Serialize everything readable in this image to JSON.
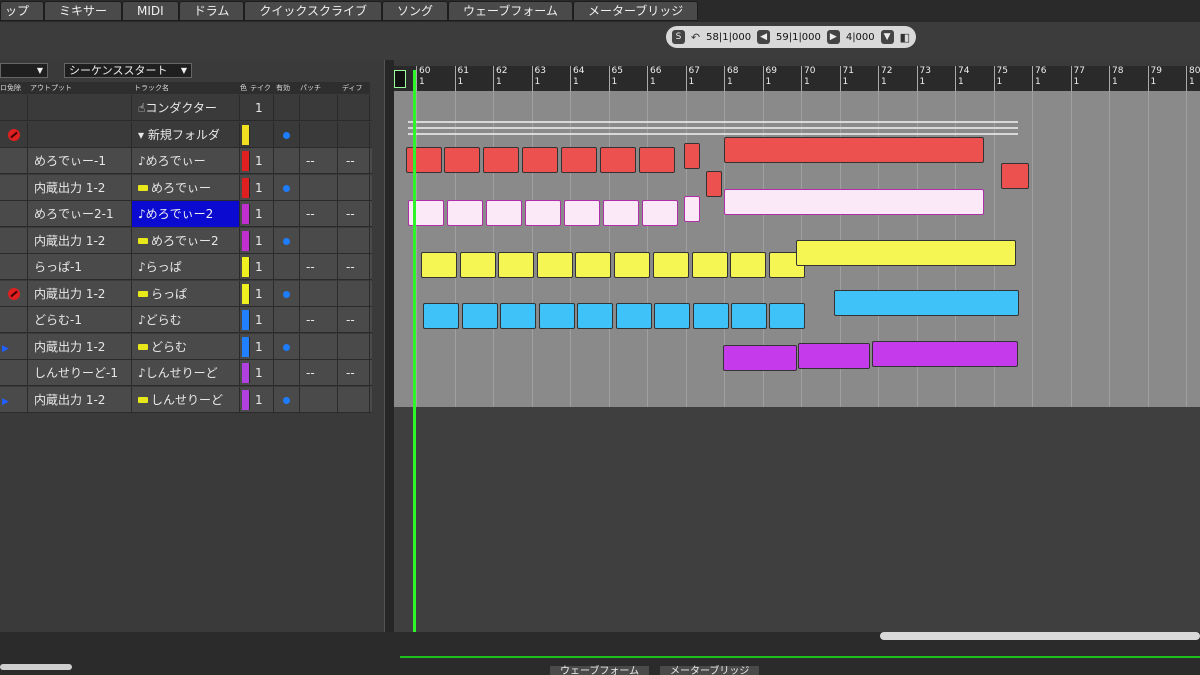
{
  "tabs": [
    "ップ",
    "ミキサー",
    "MIDI",
    "ドラム",
    "クイックスクライブ",
    "ソング",
    "ウェーブフォーム",
    "メーターブリッジ"
  ],
  "transport": {
    "s_label": "S",
    "start": "58|1|000",
    "end": "59|1|000",
    "length": "4|000"
  },
  "sequence_start": "シーケンススタート",
  "columns": {
    "rec": "ロ免除",
    "output": "アウトプット",
    "track_name": "トラック名",
    "color": "色",
    "take": "テイク",
    "enabled": "有効",
    "patch": "パッチ",
    "diff": "ディフ"
  },
  "tracks": [
    {
      "output": "",
      "name": "コンダクター",
      "take": "1",
      "color": "",
      "on": false,
      "patch": "",
      "diff": "",
      "rec": false,
      "type": "conductor"
    },
    {
      "output": "",
      "name": "新規フォルダ",
      "take": "",
      "color": "#f0e020",
      "on": true,
      "patch": "",
      "diff": "",
      "rec": true,
      "type": "folder"
    },
    {
      "output": "めろでぃー-1",
      "name": "めろでぃー",
      "take": "1",
      "color": "#e02020",
      "on": false,
      "patch": "--",
      "diff": "--",
      "rec": false,
      "type": "midi"
    },
    {
      "output": "内蔵出力 1-2",
      "name": "めろでぃー",
      "take": "1",
      "color": "#e02020",
      "on": true,
      "patch": "",
      "diff": "",
      "rec": false,
      "type": "inst"
    },
    {
      "output": "めろでぃー2-1",
      "name": "めろでぃー2",
      "take": "1",
      "color": "#c030d0",
      "on": false,
      "patch": "--",
      "diff": "--",
      "rec": false,
      "type": "midi",
      "selected": true
    },
    {
      "output": "内蔵出力 1-2",
      "name": "めろでぃー2",
      "take": "1",
      "color": "#c030d0",
      "on": true,
      "patch": "",
      "diff": "",
      "rec": false,
      "type": "inst"
    },
    {
      "output": "らっぱ-1",
      "name": "らっぱ",
      "take": "1",
      "color": "#f0f020",
      "on": false,
      "patch": "--",
      "diff": "--",
      "rec": false,
      "type": "midi"
    },
    {
      "output": "内蔵出力 1-2",
      "name": "らっぱ",
      "take": "1",
      "color": "#f0f020",
      "on": true,
      "patch": "",
      "diff": "",
      "rec": true,
      "type": "inst"
    },
    {
      "output": "どらむ-1",
      "name": "どらむ",
      "take": "1",
      "color": "#2080ff",
      "on": false,
      "patch": "--",
      "diff": "--",
      "rec": false,
      "type": "midi"
    },
    {
      "output": "内蔵出力 1-2",
      "name": "どらむ",
      "take": "1",
      "color": "#2080ff",
      "on": true,
      "patch": "",
      "diff": "",
      "rec": false,
      "type": "inst"
    },
    {
      "output": "しんせりーど-1",
      "name": "しんせりーど",
      "take": "1",
      "color": "#b040e0",
      "on": false,
      "patch": "--",
      "diff": "--",
      "rec": false,
      "type": "midi"
    },
    {
      "output": "内蔵出力 1-2",
      "name": "しんせりーど",
      "take": "1",
      "color": "#b040e0",
      "on": true,
      "patch": "",
      "diff": "",
      "rec": false,
      "type": "inst"
    }
  ],
  "ruler": [
    {
      "bar": "60",
      "beat": "1"
    },
    {
      "bar": "61",
      "beat": "1"
    },
    {
      "bar": "62",
      "beat": "1"
    },
    {
      "bar": "63",
      "beat": "1"
    },
    {
      "bar": "64",
      "beat": "1"
    },
    {
      "bar": "65",
      "beat": "1"
    },
    {
      "bar": "66",
      "beat": "1"
    },
    {
      "bar": "67",
      "beat": "1"
    },
    {
      "bar": "68",
      "beat": "1"
    },
    {
      "bar": "69",
      "beat": "1"
    },
    {
      "bar": "70",
      "beat": "1"
    },
    {
      "bar": "71",
      "beat": "1"
    },
    {
      "bar": "72",
      "beat": "1"
    },
    {
      "bar": "73",
      "beat": "1"
    },
    {
      "bar": "74",
      "beat": "1"
    },
    {
      "bar": "75",
      "beat": "1"
    },
    {
      "bar": "76",
      "beat": "1"
    },
    {
      "bar": "77",
      "beat": "1"
    },
    {
      "bar": "78",
      "beat": "1"
    },
    {
      "bar": "79",
      "beat": "1"
    },
    {
      "bar": "80",
      "beat": "1"
    }
  ],
  "bottom_tabs": [
    "ウェーブフォーム",
    "メーターブリッジ"
  ],
  "colors": {
    "red": "#ec5150",
    "white": "#fbe9f7",
    "yellow": "#f5f553",
    "blue": "#3ec2f7",
    "purple": "#c53aea",
    "playhead": "#2ef52a"
  }
}
